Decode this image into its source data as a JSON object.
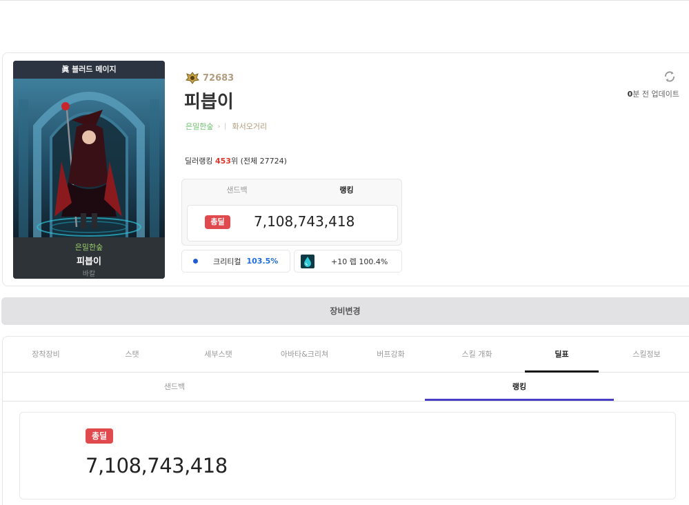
{
  "character": {
    "portrait_title": "眞 블러드 메이지",
    "portrait_server": "은밀한숲",
    "portrait_name": "피븝이",
    "portrait_job": "바칼",
    "fame": "72683",
    "name": "피븝이",
    "server": "은밀한숲",
    "guild": "화서오거리",
    "dealer_rank_prefix": "딜러랭킹 ",
    "dealer_rank_value": "453",
    "dealer_rank_suffix": "위 (전체 27724)",
    "update_num": "0",
    "update_text": "분 전 업데이트"
  },
  "damage_box": {
    "tabs": [
      "샌드백",
      "랭킹"
    ],
    "active_tab": "랭킹",
    "badge": "총딜",
    "value": "7,108,743,418"
  },
  "crit": {
    "label": "크리티컬",
    "value": "103.5%"
  },
  "item": {
    "label": "+10 렙 100.4%"
  },
  "equip_change": "장비변경",
  "main_tabs": [
    "장착장비",
    "스탯",
    "세부스탯",
    "아바타&크리쳐",
    "버프강화",
    "스킬 개화",
    "딜표",
    "스킬정보"
  ],
  "main_active_tab": "딜표",
  "sub_tabs": [
    "샌드백",
    "랭킹"
  ],
  "sub_active_tab": "랭킹",
  "total_card": {
    "badge": "총딜",
    "value": "7,108,743,418"
  },
  "colors": {
    "badge_red": "#e04a4f",
    "crit_blue": "#1d6dde",
    "server_green": "#6ec16e",
    "guild_tan": "#b09b7a",
    "sub_tab_underline": "#4a3fc4"
  }
}
